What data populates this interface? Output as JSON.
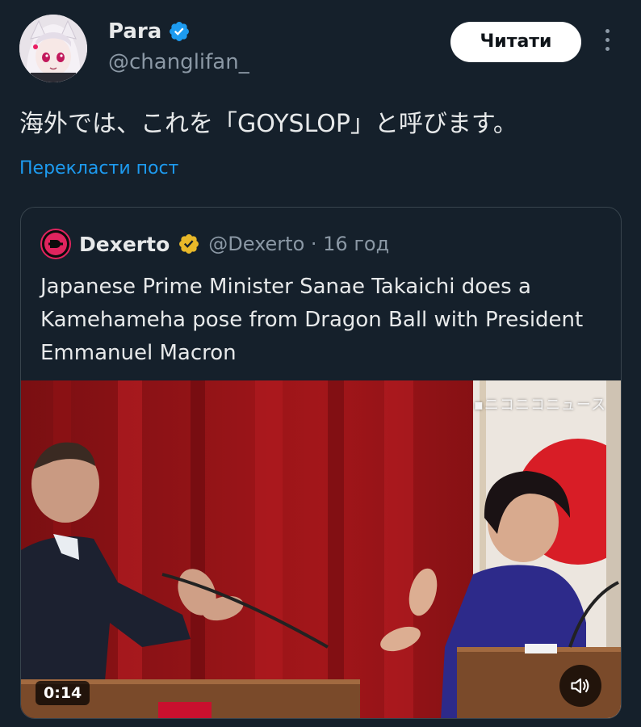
{
  "author": {
    "display_name": "Para",
    "handle": "@changlifan_",
    "avatar_icon": "anime-avatar-icon",
    "verified_icon": "verified-badge-icon"
  },
  "header": {
    "follow_label": "Читати",
    "more_icon": "more-options-icon"
  },
  "tweet": {
    "text": "海外では、これを「GOYSLOP」と呼びます。",
    "translate_label": "Перекласти пост"
  },
  "quote": {
    "display_name": "Dexerto",
    "handle_time": "@Dexerto · 16 год",
    "verified_icon": "gold-verified-badge-icon",
    "text": "Japanese Prime Minister Sanae Takaichi does a Kamehameha pose from Dragon Ball with President Emmanuel Macron",
    "media": {
      "logo_text": "▪ニコニコニュース",
      "duration": "0:14",
      "mute_icon": "volume-icon"
    }
  },
  "colors": {
    "background": "#15202b",
    "text_primary": "#e7e9ea",
    "text_secondary": "#8b98a5",
    "link": "#1d9bf0",
    "verified_blue": "#1d9bf0",
    "verified_gold": "#e8b829",
    "border": "#38444d"
  }
}
